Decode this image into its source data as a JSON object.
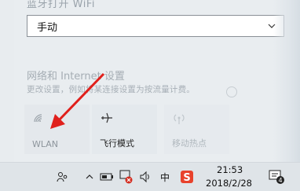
{
  "header": {
    "faded_title": "蓝牙打开 WiFi"
  },
  "dropdown": {
    "value": "手动"
  },
  "network": {
    "title": "网络和 Internet 设置",
    "description": "更改设置，例如将某连接设置为按流量计费。"
  },
  "quick_actions": [
    {
      "label": "WLAN",
      "icon": "wifi-icon",
      "state": "off"
    },
    {
      "label": "飞行模式",
      "icon": "airplane-icon",
      "state": "available"
    },
    {
      "label": "移动热点",
      "icon": "hotspot-icon",
      "state": "disabled"
    }
  ],
  "taskbar": {
    "ime_label": "中",
    "time": "21:53",
    "date": "2018/2/28",
    "notification_count": "4",
    "icons": [
      "people-icon",
      "chevron-up-icon",
      "battery-icon",
      "network-error-icon",
      "volume-icon",
      "ime-icon",
      "sogou-icon",
      "action-center-icon"
    ]
  },
  "colors": {
    "annotation_arrow": "#e0201c",
    "sogou_red": "#e8422c"
  }
}
